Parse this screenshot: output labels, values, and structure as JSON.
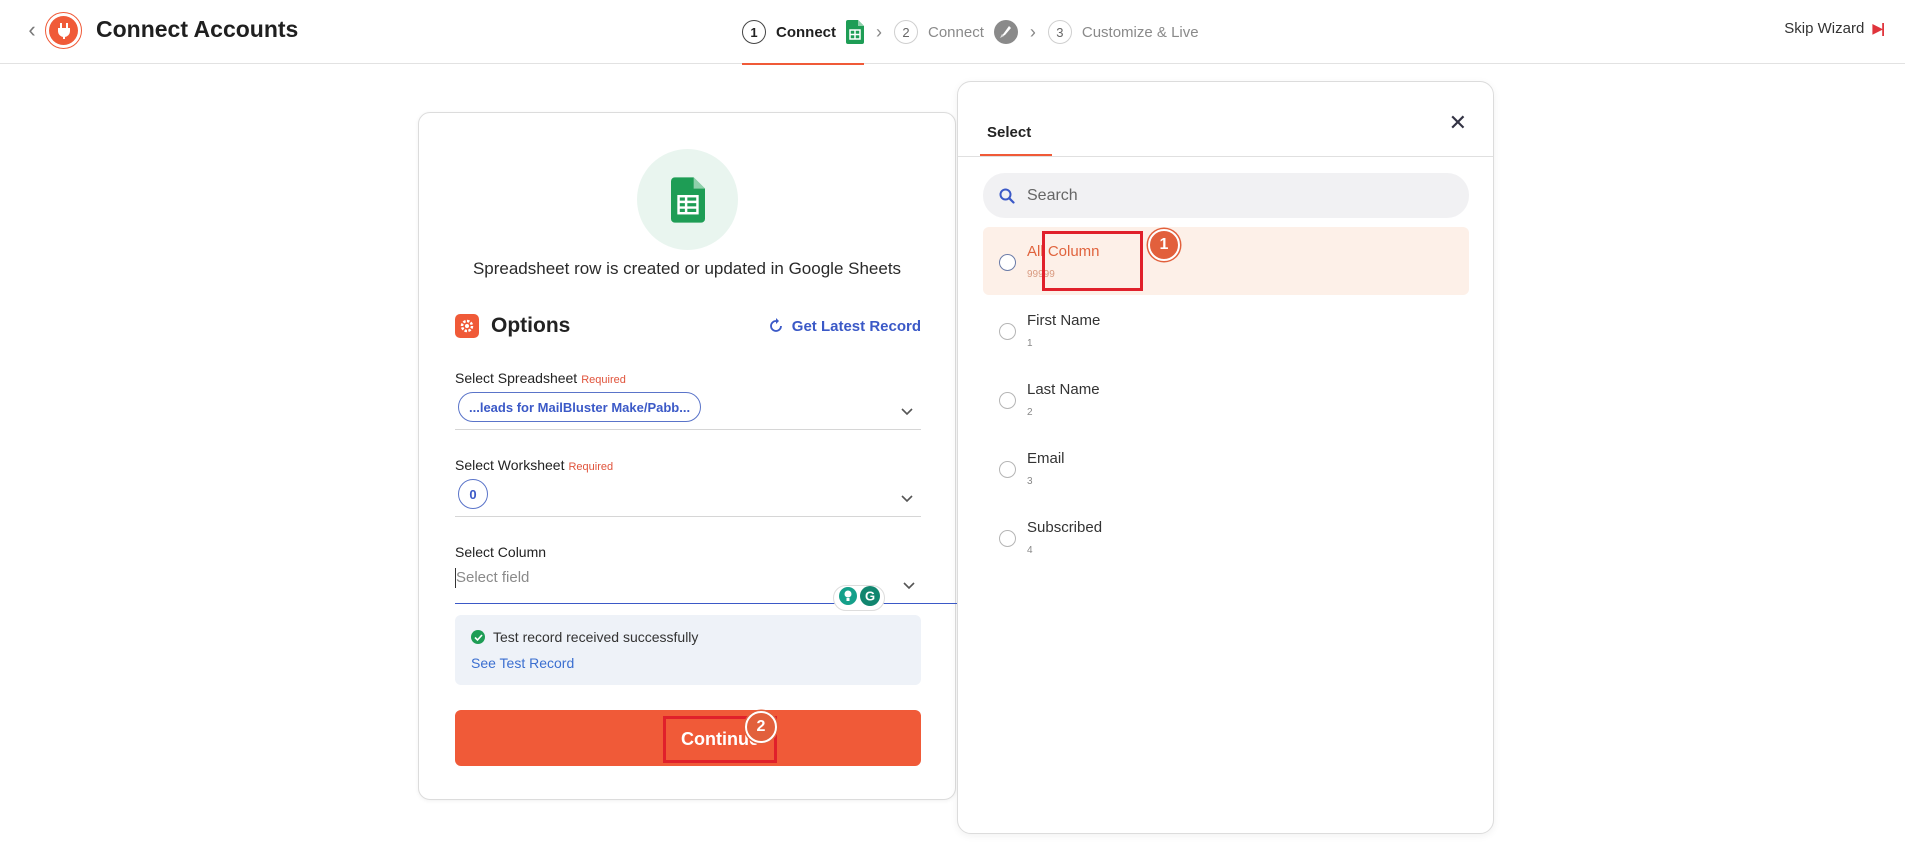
{
  "header": {
    "title": "Connect Accounts",
    "steps": [
      {
        "num": "1",
        "label": "Connect",
        "icon": "google-sheets-icon"
      },
      {
        "num": "2",
        "label": "Connect",
        "icon": "rocket-icon"
      },
      {
        "num": "3",
        "label": "Customize & Live"
      }
    ],
    "skip_label": "Skip Wizard"
  },
  "card": {
    "trigger_text": "Spreadsheet row is created or updated in Google Sheets",
    "options_title": "Options",
    "latest_record_label": "Get Latest Record",
    "fields": {
      "spreadsheet": {
        "label": "Select Spreadsheet",
        "required": "Required",
        "value": "...leads for MailBluster Make/Pabb..."
      },
      "worksheet": {
        "label": "Select Worksheet",
        "required": "Required",
        "value": "0"
      },
      "column": {
        "label": "Select Column",
        "placeholder": "Select field"
      }
    },
    "test_status": "Test record received successfully",
    "see_test_label": "See Test Record",
    "continue_label": "Continue",
    "step_marker": "2"
  },
  "panel": {
    "tab_label": "Select",
    "search_placeholder": "Search",
    "step_marker": "1",
    "options": [
      {
        "name": "All Column",
        "sub": "99999",
        "selected": true
      },
      {
        "name": "First Name",
        "sub": "1",
        "selected": false
      },
      {
        "name": "Last Name",
        "sub": "2",
        "selected": false
      },
      {
        "name": "Email",
        "sub": "3",
        "selected": false
      },
      {
        "name": "Subscribed",
        "sub": "4",
        "selected": false
      }
    ]
  },
  "colors": {
    "accent": "#f05a38",
    "link": "#3b59c7",
    "annotation": "#e0202b",
    "sheets_green": "#1e9d55"
  }
}
